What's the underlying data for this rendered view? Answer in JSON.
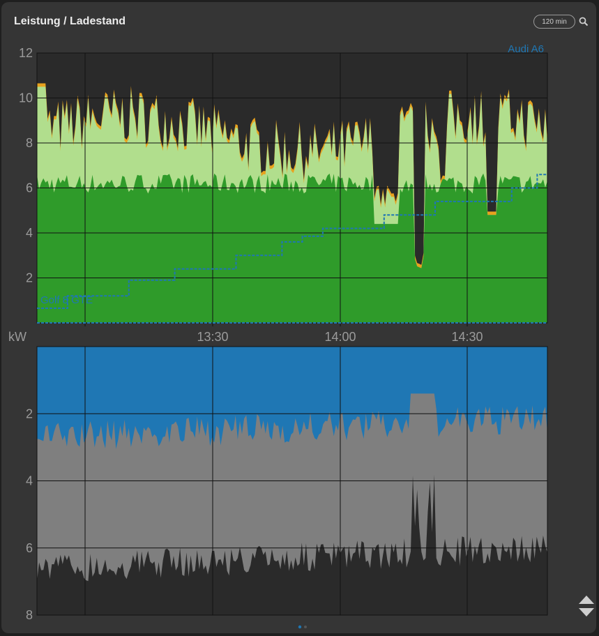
{
  "card": {
    "title": "Leistung / Ladestand",
    "range_button": "120 min",
    "search_icon": "search-icon",
    "sort_icon": "sort-updown-icon"
  },
  "colors": {
    "background": "#353535",
    "dark_area": "#2a2a2a",
    "light_green": "#b1de8d",
    "dark_green": "#2f9b2a",
    "blue": "#1f77b4",
    "gray": "#7f7f7f",
    "orange": "#e8a21e",
    "axis_text": "#9b9b9b"
  },
  "chart_data": [
    {
      "type": "area",
      "ylabel": "kW",
      "ylim": [
        0,
        12
      ],
      "yticks": [
        2,
        4,
        6,
        8,
        10,
        12
      ],
      "xticks": [
        "13:30",
        "14:00",
        "14:30"
      ],
      "grid": true,
      "annotations": [
        "Audi A6",
        "Golf 8 GTE"
      ],
      "series": [
        {
          "name": "Audi A6",
          "style": "dashed-step",
          "values": [
            [
              0.0,
              0.65
            ],
            [
              0.06,
              0.65
            ],
            [
              0.06,
              1.2
            ],
            [
              0.18,
              1.2
            ],
            [
              0.18,
              1.9
            ],
            [
              0.27,
              1.9
            ],
            [
              0.27,
              2.4
            ],
            [
              0.39,
              2.4
            ],
            [
              0.39,
              3.0
            ],
            [
              0.48,
              3.0
            ],
            [
              0.48,
              3.6
            ],
            [
              0.52,
              3.6
            ],
            [
              0.52,
              3.85
            ],
            [
              0.56,
              3.85
            ],
            [
              0.56,
              4.2
            ],
            [
              0.68,
              4.2
            ],
            [
              0.68,
              4.8
            ],
            [
              0.78,
              4.8
            ],
            [
              0.78,
              5.4
            ],
            [
              0.93,
              5.4
            ],
            [
              0.93,
              6.0
            ],
            [
              0.98,
              6.0
            ],
            [
              0.98,
              6.6
            ],
            [
              1.0,
              6.6
            ]
          ]
        },
        {
          "name": "Golf 8 GTE",
          "style": "dashed-flat",
          "values": [
            [
              0.0,
              0.0
            ],
            [
              1.0,
              0.0
            ]
          ]
        }
      ]
    },
    {
      "type": "area",
      "ylim": [
        0,
        8
      ],
      "yticks": [
        2,
        4,
        6,
        8
      ],
      "xticks": [
        "13:30",
        "14:00",
        "14:30"
      ],
      "grid": true
    }
  ]
}
